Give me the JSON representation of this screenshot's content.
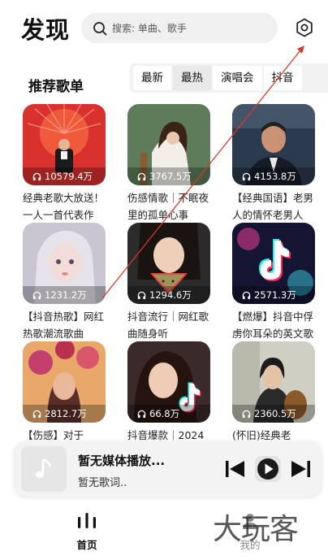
{
  "header": {
    "title": "发现",
    "search_placeholder": "搜索: 单曲、歌手",
    "settings_icon": "gear-icon"
  },
  "section": {
    "title": "推荐歌单",
    "tabs": [
      {
        "label": "最新",
        "active": false
      },
      {
        "label": "最热",
        "active": true
      },
      {
        "label": "演唱会",
        "active": false
      },
      {
        "label": "抖音",
        "active": false
      }
    ]
  },
  "playlists": [
    {
      "play_count": "10579.4万",
      "title": "经典老歌大放送！一人一首代表作",
      "cover_color": "#d9312e"
    },
    {
      "play_count": "3767.5万",
      "title": "伤感情歌｜不眠夜里的孤单心事",
      "cover_color": "#5e7c5a"
    },
    {
      "play_count": "4153.8万",
      "title": "【经典国语】老男人的情怀老男人",
      "cover_color": "#2c3a4d"
    },
    {
      "play_count": "1231.2万",
      "title": "【抖音热歌】网红热歌潮流歌曲",
      "cover_color": "#c9c6d2"
    },
    {
      "play_count": "1294.6万",
      "title": "抖音流行｜网红歌曲随身听",
      "cover_color": "#2b2b2b"
    },
    {
      "play_count": "2571.3万",
      "title": "【燃爆】抖音中俘虏你耳朵的英文歌",
      "cover_color": "#141433"
    },
    {
      "play_count": "2812.7万",
      "title": "【伤感】对于",
      "cover_color": "#e7a86a"
    },
    {
      "play_count": "66.8万",
      "title": "抖音爆款｜2024",
      "cover_color": "#3a2a2a"
    },
    {
      "play_count": "2360.5万",
      "title": "(怀旧)经典老",
      "cover_color": "#cfcfc4"
    }
  ],
  "player": {
    "title": "暂无媒体播放...",
    "subtitle": "暂无歌词..",
    "icons": [
      "music-note-icon",
      "previous-icon",
      "play-icon",
      "next-icon"
    ]
  },
  "nav": {
    "home_label": "首页",
    "mine_label": "我的"
  },
  "watermark": "大玩客",
  "colors": {
    "accent": "#111111",
    "annotation_line": "#d9372b"
  }
}
